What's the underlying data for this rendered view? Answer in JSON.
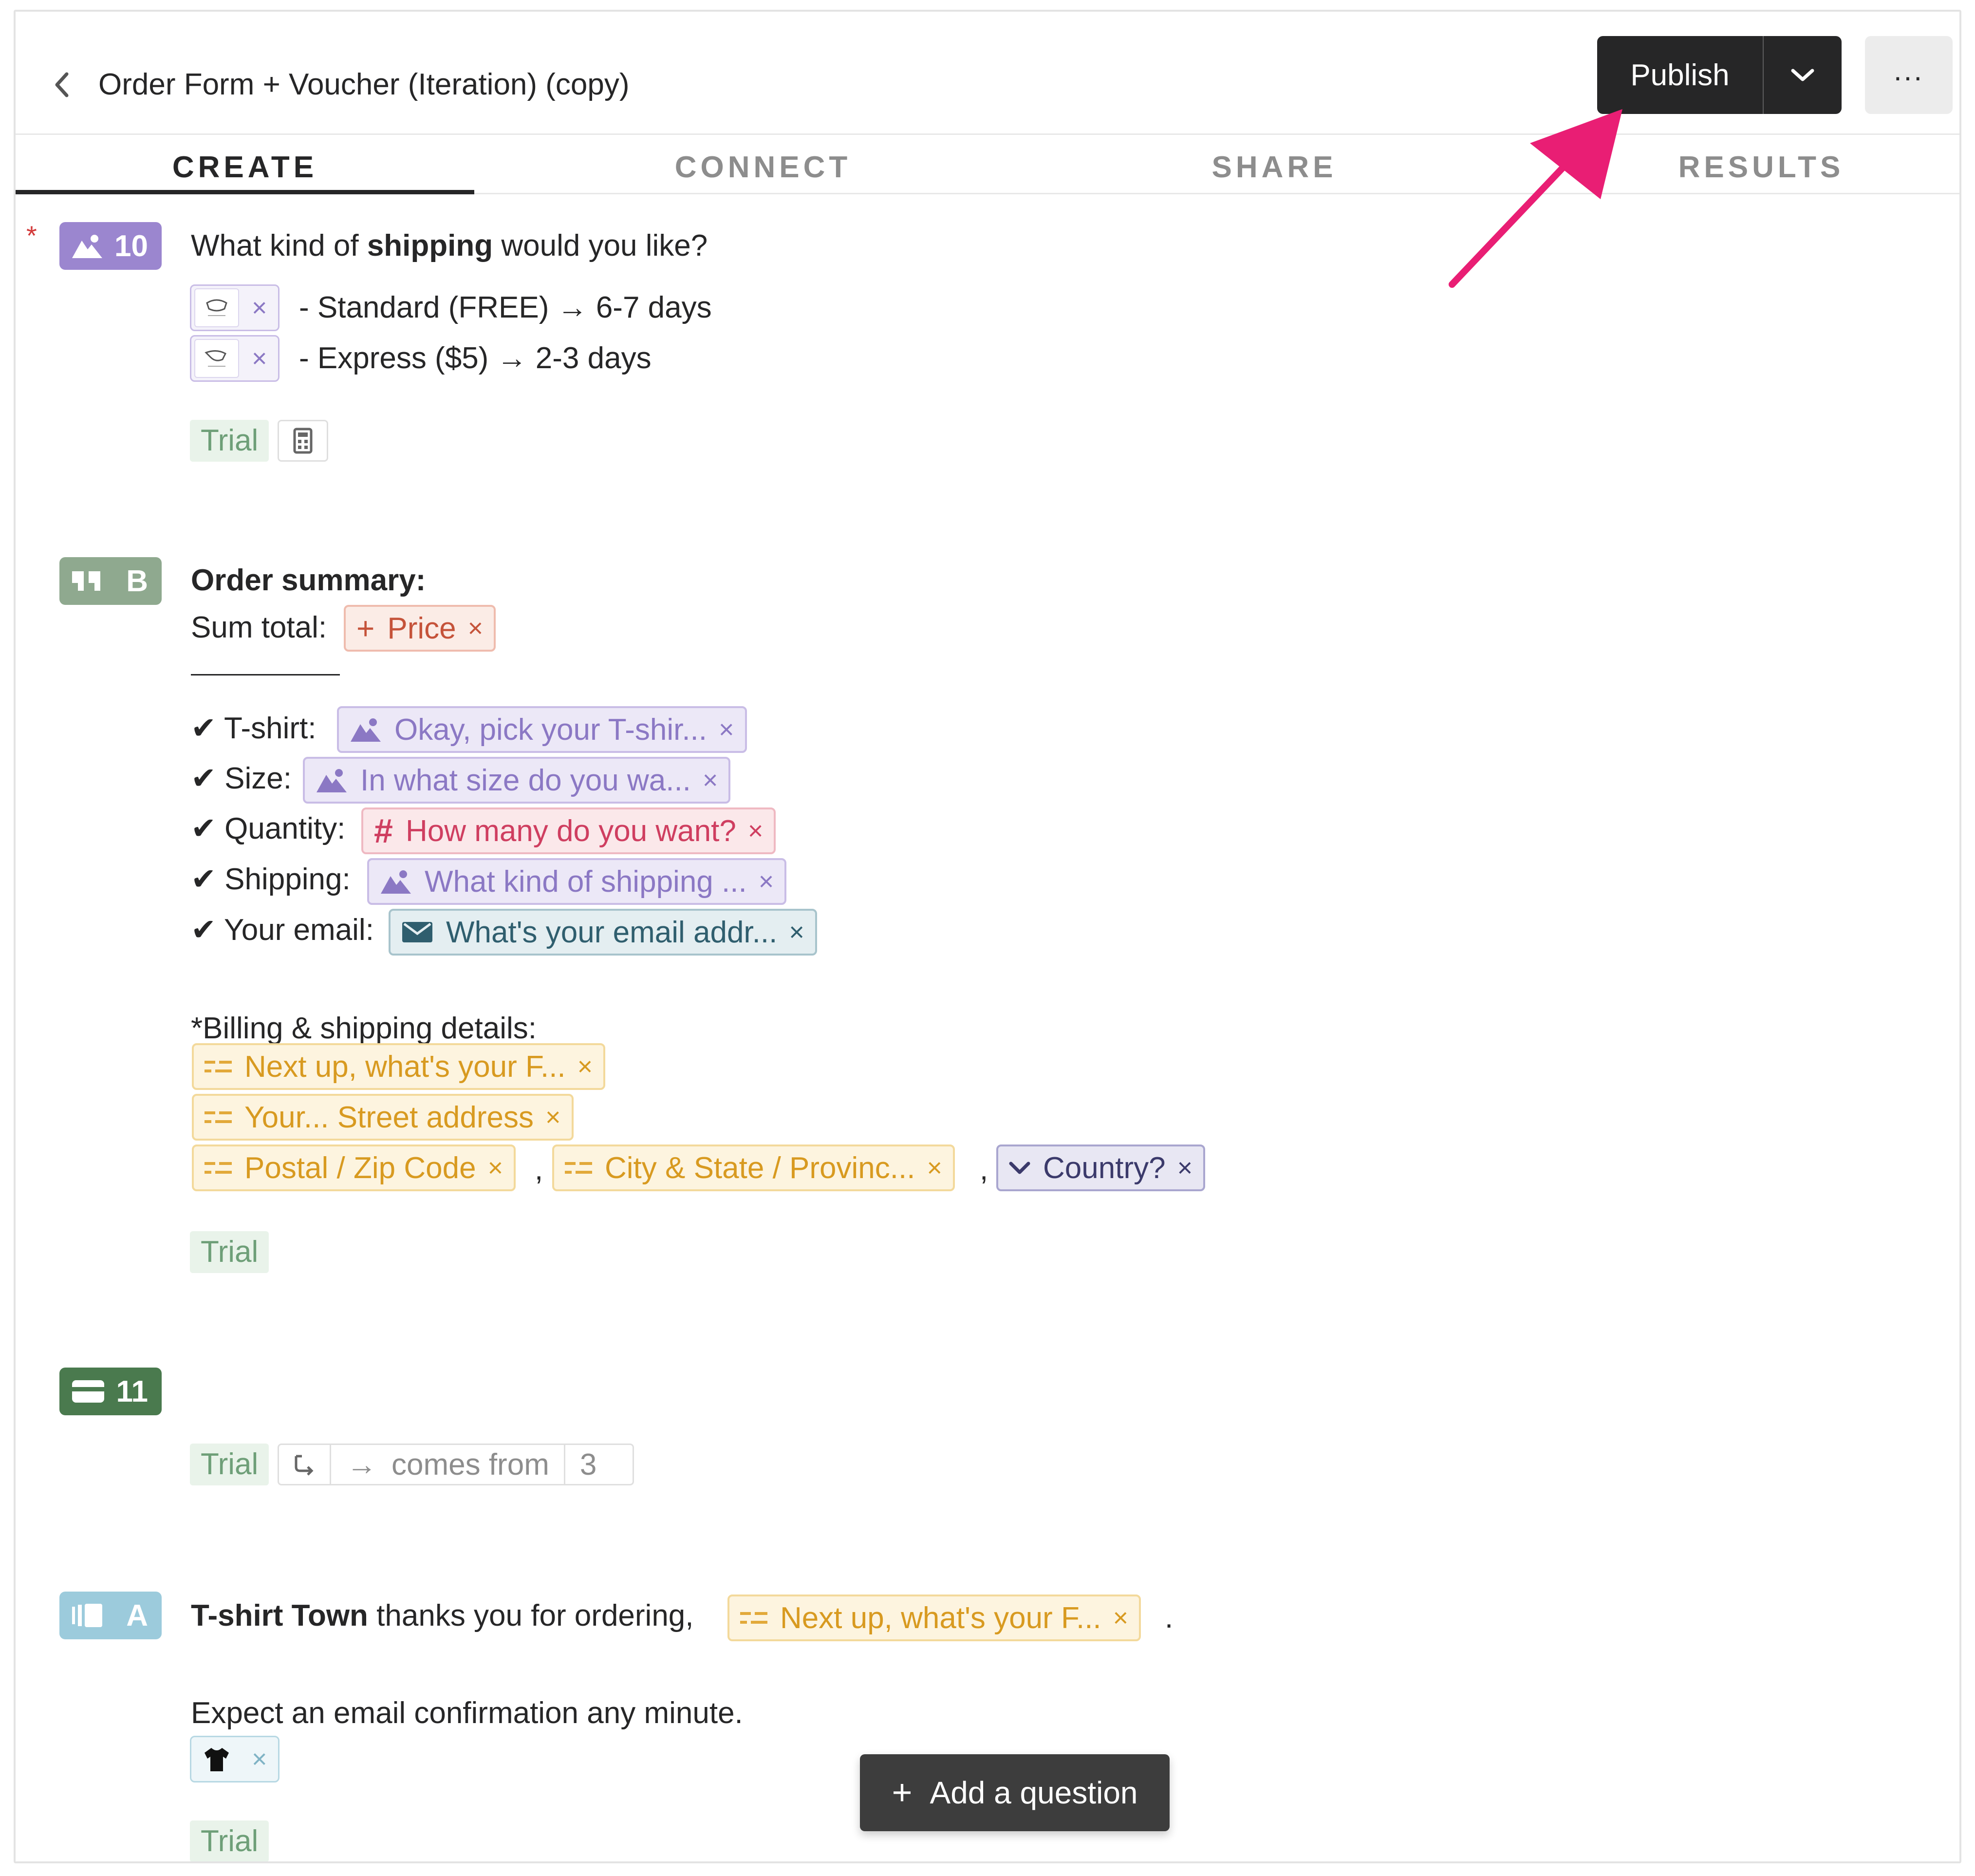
{
  "header": {
    "title": "Order Form + Voucher (Iteration) (copy)",
    "publish_label": "Publish",
    "more_label": "..."
  },
  "tabs": [
    {
      "label": "CREATE",
      "active": true
    },
    {
      "label": "CONNECT",
      "active": false
    },
    {
      "label": "SHARE",
      "active": false
    },
    {
      "label": "RESULTS",
      "active": false
    }
  ],
  "block10": {
    "required_mark": "*",
    "number": "10",
    "question_pre": "What kind of ",
    "question_bold": "shipping",
    "question_post": " would you like?",
    "choices": [
      {
        "label": "- Standard (FREE) → 6-7 days"
      },
      {
        "label": "- Express ($5) → 2-3 days"
      }
    ],
    "trial": "Trial",
    "remove_icon": "×"
  },
  "blockB": {
    "letter": "B",
    "heading": "Order summary:",
    "sum_label": "Sum total:",
    "price_chip": "Price",
    "lines": [
      {
        "label": "✔ T-shirt:",
        "chip": "Okay, pick your T-shir..."
      },
      {
        "label": "✔ Size:",
        "chip": "In what size do you wa..."
      },
      {
        "label": "✔ Quantity:",
        "chip": "How many do you want?"
      },
      {
        "label": "✔ Shipping:",
        "chip": "What kind of shipping ..."
      },
      {
        "label": "✔ Your email:",
        "chip": "What's your email addr..."
      }
    ],
    "billing_label": "*Billing & shipping details:",
    "billing_chips": [
      "Next up, what's your F...",
      "Your... Street address",
      "Postal / Zip Code",
      "City & State / Provinc...",
      "Country?"
    ],
    "comma": ",",
    "trial": "Trial"
  },
  "block11": {
    "number": "11",
    "trial": "Trial",
    "arrow": "→",
    "comes_from": "comes from",
    "from_number": "3"
  },
  "blockA": {
    "letter": "A",
    "thanks_bold": "T-shirt Town",
    "thanks_text": " thanks you for ordering,",
    "name_chip": "Next up, what's your F...",
    "period": ".",
    "confirm": "Expect an email confirmation any minute.",
    "trial": "Trial"
  },
  "add_question": "Add a question",
  "colors": {
    "dark": "#262627",
    "purple": "#9b86cf",
    "green_badge": "#8fa98f",
    "dark_green": "#4a7a4e",
    "blue_badge": "#9ccbdc",
    "arrow": "#e91e74"
  },
  "icons": {
    "back": "chevron-left-icon",
    "caret": "chevron-down-icon",
    "image": "image-icon",
    "quote": "quote-icon",
    "payment": "credit-card-icon",
    "ending": "ending-icon",
    "hash": "hash-icon",
    "email": "envelope-icon",
    "text": "short-text-icon",
    "dropdown": "dropdown-icon",
    "calc": "calculator-icon",
    "logic": "branch-icon",
    "tshirt": "tshirt-icon"
  }
}
